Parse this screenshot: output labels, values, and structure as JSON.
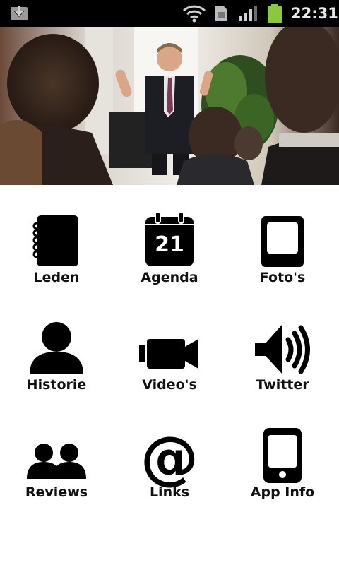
{
  "status_bar": {
    "time": "22:31",
    "icons": [
      "download-icon",
      "wifi-icon",
      "sim-card-icon",
      "signal-icon",
      "battery-icon"
    ]
  },
  "hero": {
    "image": "presenter-photo"
  },
  "menu": {
    "items": [
      {
        "label": "Leden",
        "icon": "notebook-icon"
      },
      {
        "label": "Agenda",
        "icon": "calendar-icon",
        "day": "21"
      },
      {
        "label": "Foto's",
        "icon": "photo-frame-icon"
      },
      {
        "label": "Historie",
        "icon": "person-icon"
      },
      {
        "label": "Video's",
        "icon": "video-camera-icon"
      },
      {
        "label": "Twitter",
        "icon": "speaker-icon"
      },
      {
        "label": "Reviews",
        "icon": "people-icon"
      },
      {
        "label": "Links",
        "icon": "at-sign-icon"
      },
      {
        "label": "App Info",
        "icon": "phone-icon"
      }
    ]
  }
}
